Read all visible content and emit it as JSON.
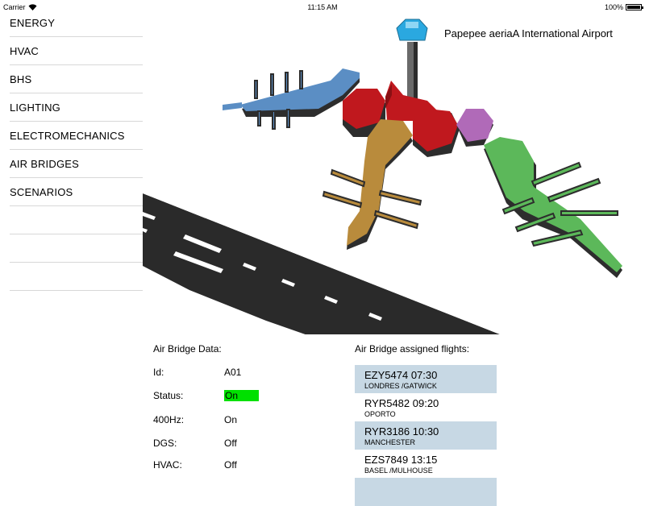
{
  "status_bar": {
    "carrier": "Carrier",
    "time": "11:15 AM",
    "battery": "100%"
  },
  "menu": {
    "items": [
      {
        "label": "ENERGY"
      },
      {
        "label": "HVAC"
      },
      {
        "label": "BHS"
      },
      {
        "label": "LIGHTING"
      },
      {
        "label": "ELECTROMECHANICS"
      },
      {
        "label": "AIR BRIDGES"
      },
      {
        "label": "SCENARIOS"
      },
      {
        "label": ""
      },
      {
        "label": ""
      },
      {
        "label": ""
      }
    ]
  },
  "map": {
    "title": "Papepee aeriaA International Airport",
    "colors": {
      "pier_blue": "#5b8ec4",
      "terminal_red": "#c0181e",
      "pier_gold": "#b98b3c",
      "hub_purple": "#b06ab8",
      "pier_green": "#5cb85a",
      "tower": "#2aa8e0",
      "runway": "#2a2a2a"
    }
  },
  "air_bridge_data": {
    "heading": "Air Bridge Data:",
    "id_label": "Id:",
    "id_value": "A01",
    "status_label": "Status:",
    "status_value": "On",
    "hz_label": "400Hz:",
    "hz_value": "On",
    "dgs_label": "DGS:",
    "dgs_value": "Off",
    "hvac_label": "HVAC:",
    "hvac_value": "Off",
    "status_color": "#00e000"
  },
  "flights": {
    "heading": "Air Bridge assigned flights:",
    "highlight_color": "#c7d8e4",
    "items": [
      {
        "code": "EZY5474 07:30",
        "dest": "LONDRES /GATWICK"
      },
      {
        "code": "RYR5482 09:20",
        "dest": "OPORTO"
      },
      {
        "code": "RYR3186 10:30",
        "dest": "MANCHESTER"
      },
      {
        "code": "EZS7849 13:15",
        "dest": "BASEL /MULHOUSE"
      },
      {
        "code": "",
        "dest": ""
      }
    ]
  }
}
